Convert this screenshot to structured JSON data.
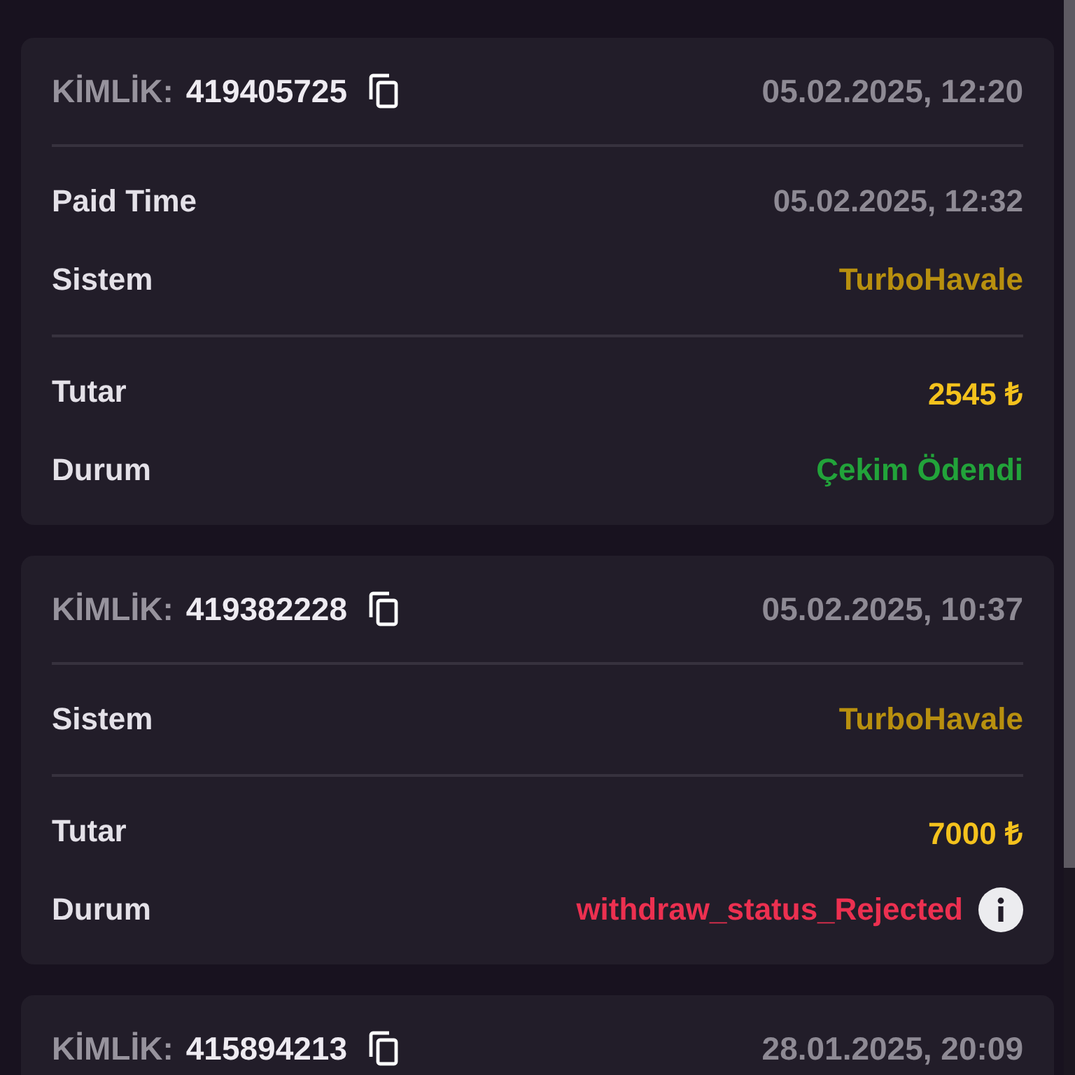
{
  "cards": [
    {
      "id_label": "KİMLİK:",
      "id": "419405725",
      "date": "05.02.2025, 12:20",
      "sections": [
        [
          {
            "label": "Paid Time",
            "value": "05.02.2025, 12:32",
            "kind": "date"
          },
          {
            "label": "Sistem",
            "value": "TurboHavale",
            "kind": "system"
          }
        ],
        [
          {
            "label": "Tutar",
            "value": "2545 ₺",
            "kind": "amount"
          },
          {
            "label": "Durum",
            "value": "Çekim Ödendi",
            "kind": "success",
            "info": false
          }
        ]
      ]
    },
    {
      "id_label": "KİMLİK:",
      "id": "419382228",
      "date": "05.02.2025, 10:37",
      "sections": [
        [
          {
            "label": "Sistem",
            "value": "TurboHavale",
            "kind": "system"
          }
        ],
        [
          {
            "label": "Tutar",
            "value": "7000 ₺",
            "kind": "amount"
          },
          {
            "label": "Durum",
            "value": "withdraw_status_Rejected",
            "kind": "error",
            "info": true
          }
        ]
      ]
    },
    {
      "id_label": "KİMLİK:",
      "id": "415894213",
      "date": "28.01.2025, 20:09"
    }
  ]
}
